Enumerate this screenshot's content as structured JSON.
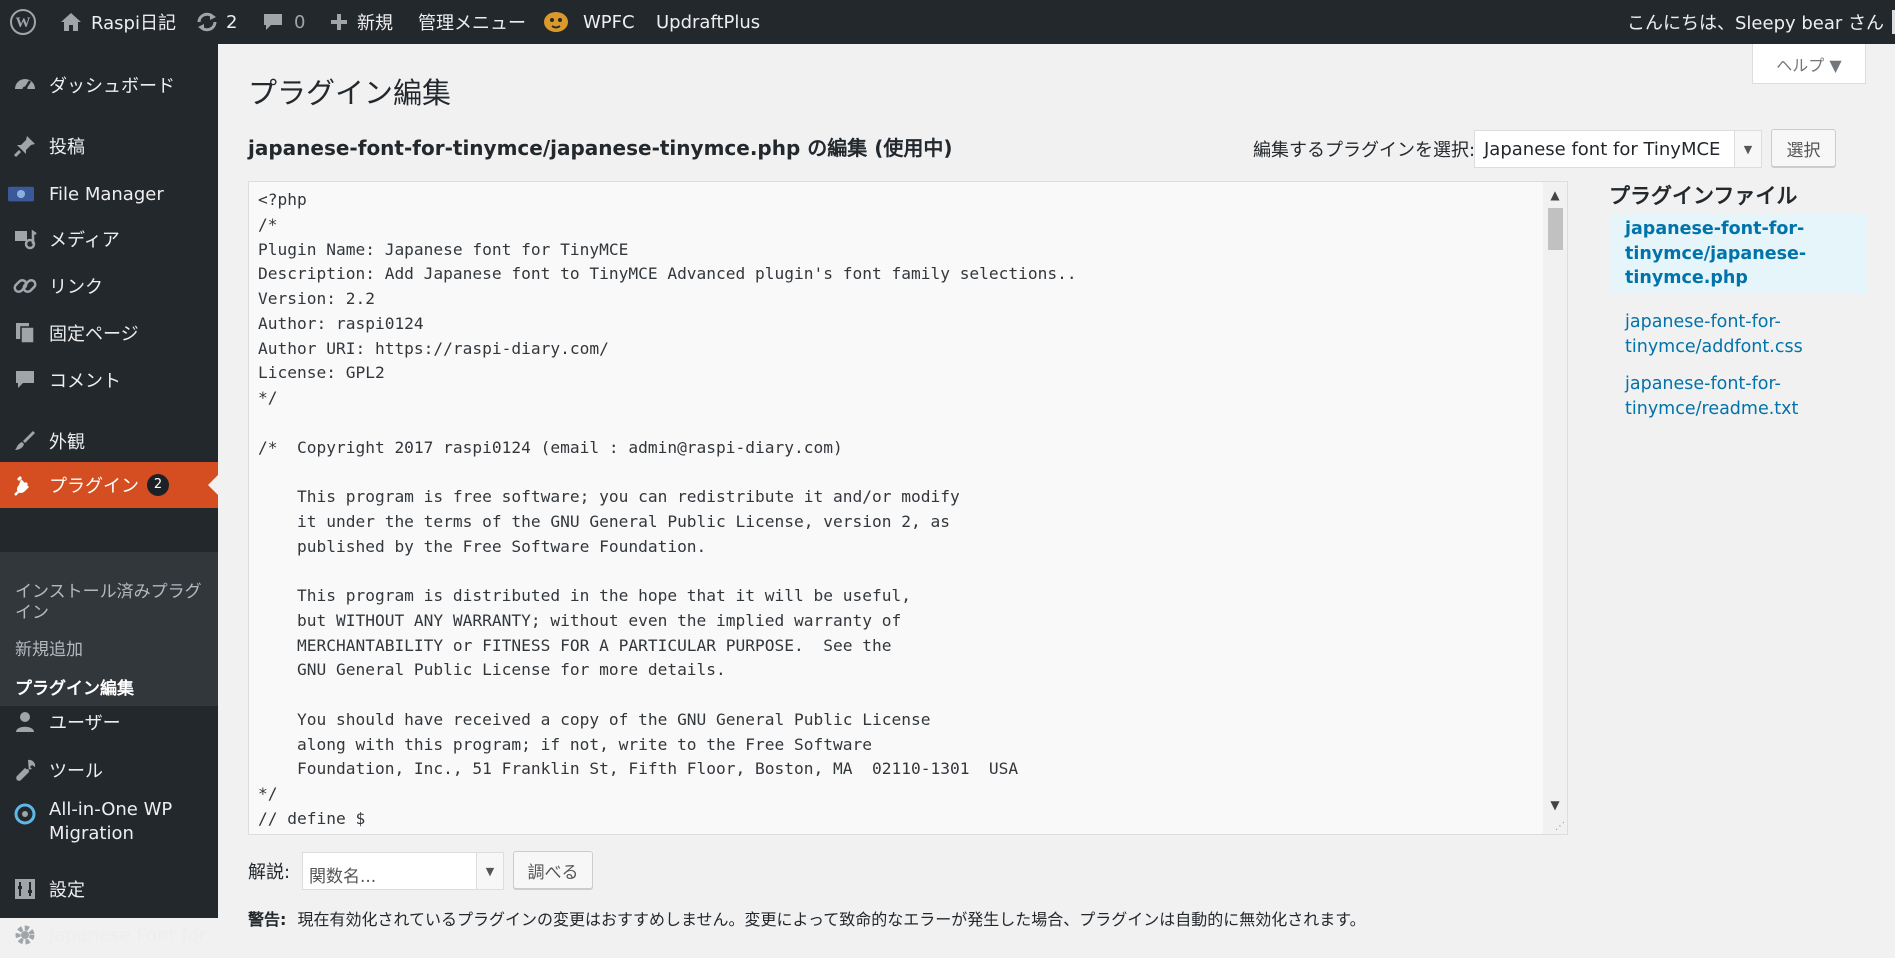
{
  "adminbar": {
    "site_name": "Raspi日記",
    "updates_count": "2",
    "comments_count": "0",
    "new_label": "新規",
    "admin_menu_label": "管理メニュー",
    "wpfc_label": "WPFC",
    "updraft_label": "UpdraftPlus",
    "greeting": "こんにちは、Sleepy bear さん"
  },
  "sidebar": {
    "items": [
      {
        "label": "ダッシュボード",
        "icon": "dashboard-icon"
      },
      {
        "label": "投稿",
        "icon": "pushpin-icon"
      },
      {
        "label": "File Manager",
        "icon": "file-manager-icon"
      },
      {
        "label": "メディア",
        "icon": "media-icon"
      },
      {
        "label": "リンク",
        "icon": "link-icon"
      },
      {
        "label": "固定ページ",
        "icon": "pages-icon"
      },
      {
        "label": "コメント",
        "icon": "comment-icon"
      },
      {
        "label": "外観",
        "icon": "appearance-icon"
      },
      {
        "label": "プラグイン",
        "icon": "plugins-icon",
        "badge": "2"
      },
      {
        "label": "ユーザー",
        "icon": "user-icon"
      },
      {
        "label": "ツール",
        "icon": "tools-icon"
      },
      {
        "label": "All-in-One WP Migration",
        "icon": "migration-icon"
      },
      {
        "label": "設定",
        "icon": "settings-icon"
      },
      {
        "label": "Japanese Font for",
        "icon": "gear-icon"
      }
    ],
    "submenu": [
      "インストール済みプラグイン",
      "新規追加",
      "プラグイン編集"
    ]
  },
  "help_tab": {
    "label": "ヘルプ ▼"
  },
  "page": {
    "title": "プラグイン編集",
    "file_heading": "japanese-font-for-tinymce/japanese-tinymce.php の編集 (使用中)",
    "select_label": "編集するプラグインを選択:",
    "select_value": "Japanese font for TinyMCE",
    "select_button": "選択"
  },
  "editor": {
    "code": "<?php\n/*\nPlugin Name: Japanese font for TinyMCE\nDescription: Add Japanese font to TinyMCE Advanced plugin's font family selections..\nVersion: 2.2\nAuthor: raspi0124\nAuthor URI: https://raspi-diary.com/\nLicense: GPL2\n*/\n\n/*  Copyright 2017 raspi0124 (email : admin@raspi-diary.com)\n\n    This program is free software; you can redistribute it and/or modify\n    it under the terms of the GNU General Public License, version 2, as\n    published by the Free Software Foundation.\n\n    This program is distributed in the hope that it will be useful,\n    but WITHOUT ANY WARRANTY; without even the implied warranty of\n    MERCHANTABILITY or FITNESS FOR A PARTICULAR PURPOSE.  See the\n    GNU General Public License for more details.\n\n    You should have received a copy of the GNU General Public License\n    along with this program; if not, write to the Free Software\n    Foundation, Inc., 51 Franklin St, Fifth Floor, Boston, MA  02110-1301  USA\n*/\n// define $"
  },
  "plugin_files": {
    "heading": "プラグインファイル",
    "files": [
      {
        "path": "japanese-font-for-tinymce/japanese-tinymce.php",
        "active": true
      },
      {
        "path": "japanese-font-for-tinymce/addfont.css",
        "active": false
      },
      {
        "path": "japanese-font-for-tinymce/readme.txt",
        "active": false
      }
    ]
  },
  "documentation": {
    "label": "解説:",
    "placeholder": "関数名...",
    "button": "調べる"
  },
  "notice": {
    "prefix": "警告:",
    "text": "現在有効化されているプラグインの変更はおすすめしません。変更によって致命的なエラーが発生した場合、プラグインは自動的に無効化されます。"
  },
  "colors": {
    "adminbar": "#23282d",
    "sidebar": "#23282d",
    "current_menu": "#d54e21",
    "link": "#0073aa",
    "background": "#f1f1f1"
  }
}
